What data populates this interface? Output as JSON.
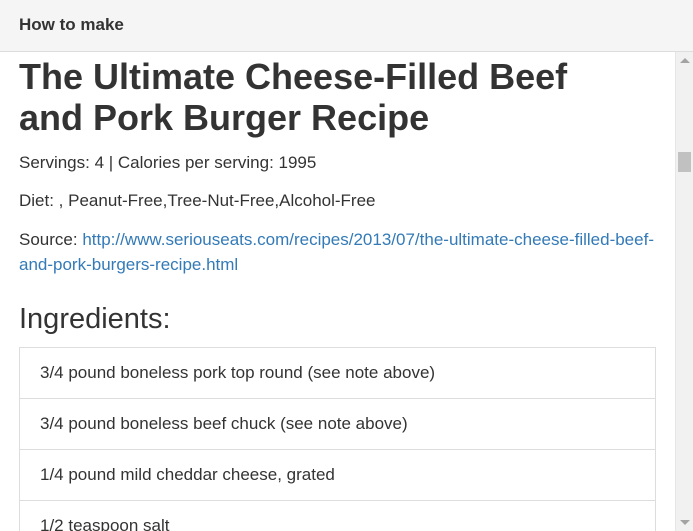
{
  "header": {
    "title": "How to make"
  },
  "recipe": {
    "title": "The Ultimate Cheese-Filled Beef and Pork Burger Recipe",
    "servings_line": "Servings: 4 | Calories per serving: 1995",
    "diet_line": "Diet: , Peanut-Free,Tree-Nut-Free,Alcohol-Free",
    "source_label": "Source: ",
    "source_url": "http://www.seriouseats.com/recipes/2013/07/the-ultimate-cheese-filled-beef-and-pork-burgers-recipe.html"
  },
  "ingredients": {
    "heading": "Ingredients:",
    "items": [
      "3/4 pound boneless pork top round (see note above)",
      "3/4 pound boneless beef chuck (see note above)",
      "1/4 pound mild cheddar cheese, grated",
      "1/2 teaspoon salt"
    ]
  },
  "scrollbar": {
    "icons": [
      "scroll-up-arrow-icon",
      "scroll-down-arrow-icon"
    ]
  }
}
